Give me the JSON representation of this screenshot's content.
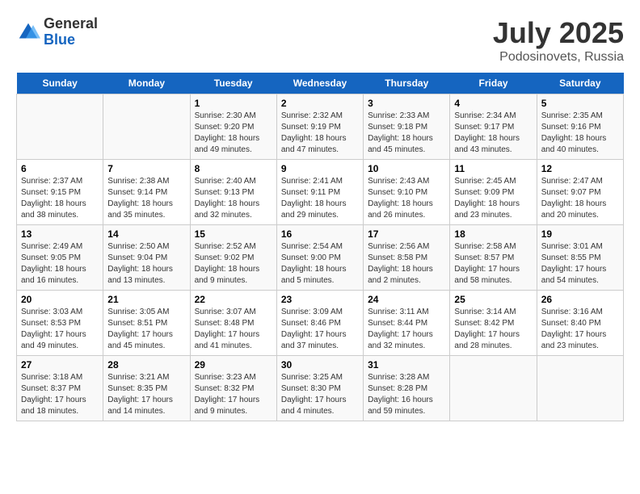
{
  "header": {
    "logo_general": "General",
    "logo_blue": "Blue",
    "month": "July 2025",
    "location": "Podosinovets, Russia"
  },
  "days_of_week": [
    "Sunday",
    "Monday",
    "Tuesday",
    "Wednesday",
    "Thursday",
    "Friday",
    "Saturday"
  ],
  "weeks": [
    [
      {
        "day": "",
        "info": ""
      },
      {
        "day": "",
        "info": ""
      },
      {
        "day": "1",
        "info": "Sunrise: 2:30 AM\nSunset: 9:20 PM\nDaylight: 18 hours\nand 49 minutes."
      },
      {
        "day": "2",
        "info": "Sunrise: 2:32 AM\nSunset: 9:19 PM\nDaylight: 18 hours\nand 47 minutes."
      },
      {
        "day": "3",
        "info": "Sunrise: 2:33 AM\nSunset: 9:18 PM\nDaylight: 18 hours\nand 45 minutes."
      },
      {
        "day": "4",
        "info": "Sunrise: 2:34 AM\nSunset: 9:17 PM\nDaylight: 18 hours\nand 43 minutes."
      },
      {
        "day": "5",
        "info": "Sunrise: 2:35 AM\nSunset: 9:16 PM\nDaylight: 18 hours\nand 40 minutes."
      }
    ],
    [
      {
        "day": "6",
        "info": "Sunrise: 2:37 AM\nSunset: 9:15 PM\nDaylight: 18 hours\nand 38 minutes."
      },
      {
        "day": "7",
        "info": "Sunrise: 2:38 AM\nSunset: 9:14 PM\nDaylight: 18 hours\nand 35 minutes."
      },
      {
        "day": "8",
        "info": "Sunrise: 2:40 AM\nSunset: 9:13 PM\nDaylight: 18 hours\nand 32 minutes."
      },
      {
        "day": "9",
        "info": "Sunrise: 2:41 AM\nSunset: 9:11 PM\nDaylight: 18 hours\nand 29 minutes."
      },
      {
        "day": "10",
        "info": "Sunrise: 2:43 AM\nSunset: 9:10 PM\nDaylight: 18 hours\nand 26 minutes."
      },
      {
        "day": "11",
        "info": "Sunrise: 2:45 AM\nSunset: 9:09 PM\nDaylight: 18 hours\nand 23 minutes."
      },
      {
        "day": "12",
        "info": "Sunrise: 2:47 AM\nSunset: 9:07 PM\nDaylight: 18 hours\nand 20 minutes."
      }
    ],
    [
      {
        "day": "13",
        "info": "Sunrise: 2:49 AM\nSunset: 9:05 PM\nDaylight: 18 hours\nand 16 minutes."
      },
      {
        "day": "14",
        "info": "Sunrise: 2:50 AM\nSunset: 9:04 PM\nDaylight: 18 hours\nand 13 minutes."
      },
      {
        "day": "15",
        "info": "Sunrise: 2:52 AM\nSunset: 9:02 PM\nDaylight: 18 hours\nand 9 minutes."
      },
      {
        "day": "16",
        "info": "Sunrise: 2:54 AM\nSunset: 9:00 PM\nDaylight: 18 hours\nand 5 minutes."
      },
      {
        "day": "17",
        "info": "Sunrise: 2:56 AM\nSunset: 8:58 PM\nDaylight: 18 hours\nand 2 minutes."
      },
      {
        "day": "18",
        "info": "Sunrise: 2:58 AM\nSunset: 8:57 PM\nDaylight: 17 hours\nand 58 minutes."
      },
      {
        "day": "19",
        "info": "Sunrise: 3:01 AM\nSunset: 8:55 PM\nDaylight: 17 hours\nand 54 minutes."
      }
    ],
    [
      {
        "day": "20",
        "info": "Sunrise: 3:03 AM\nSunset: 8:53 PM\nDaylight: 17 hours\nand 49 minutes."
      },
      {
        "day": "21",
        "info": "Sunrise: 3:05 AM\nSunset: 8:51 PM\nDaylight: 17 hours\nand 45 minutes."
      },
      {
        "day": "22",
        "info": "Sunrise: 3:07 AM\nSunset: 8:48 PM\nDaylight: 17 hours\nand 41 minutes."
      },
      {
        "day": "23",
        "info": "Sunrise: 3:09 AM\nSunset: 8:46 PM\nDaylight: 17 hours\nand 37 minutes."
      },
      {
        "day": "24",
        "info": "Sunrise: 3:11 AM\nSunset: 8:44 PM\nDaylight: 17 hours\nand 32 minutes."
      },
      {
        "day": "25",
        "info": "Sunrise: 3:14 AM\nSunset: 8:42 PM\nDaylight: 17 hours\nand 28 minutes."
      },
      {
        "day": "26",
        "info": "Sunrise: 3:16 AM\nSunset: 8:40 PM\nDaylight: 17 hours\nand 23 minutes."
      }
    ],
    [
      {
        "day": "27",
        "info": "Sunrise: 3:18 AM\nSunset: 8:37 PM\nDaylight: 17 hours\nand 18 minutes."
      },
      {
        "day": "28",
        "info": "Sunrise: 3:21 AM\nSunset: 8:35 PM\nDaylight: 17 hours\nand 14 minutes."
      },
      {
        "day": "29",
        "info": "Sunrise: 3:23 AM\nSunset: 8:32 PM\nDaylight: 17 hours\nand 9 minutes."
      },
      {
        "day": "30",
        "info": "Sunrise: 3:25 AM\nSunset: 8:30 PM\nDaylight: 17 hours\nand 4 minutes."
      },
      {
        "day": "31",
        "info": "Sunrise: 3:28 AM\nSunset: 8:28 PM\nDaylight: 16 hours\nand 59 minutes."
      },
      {
        "day": "",
        "info": ""
      },
      {
        "day": "",
        "info": ""
      }
    ]
  ]
}
